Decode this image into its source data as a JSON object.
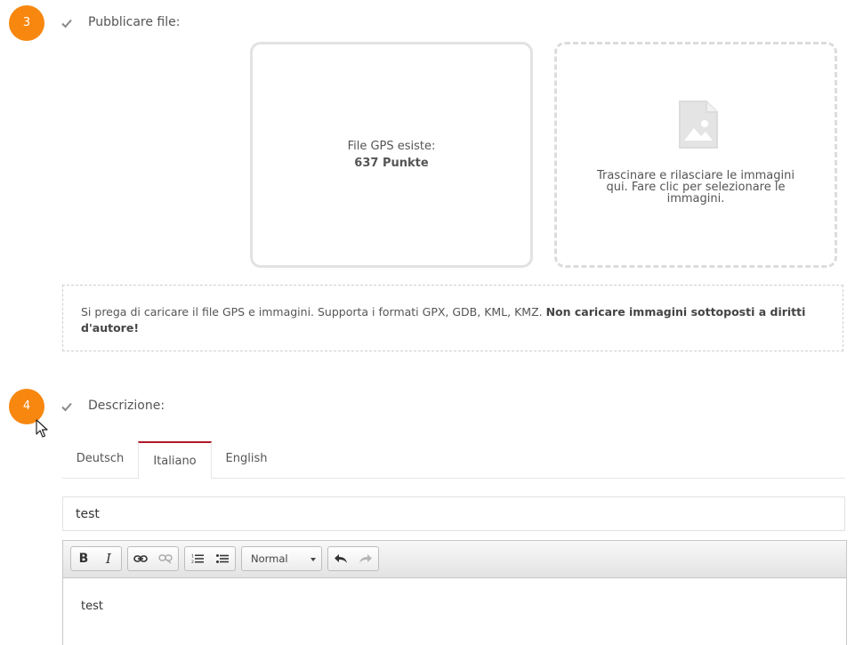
{
  "step3": {
    "number": "3",
    "title": "Pubblicare file:"
  },
  "gps_box": {
    "label": "File GPS esiste:",
    "count": "637 Punkte"
  },
  "image_drop": {
    "icon": "image-file-icon",
    "text": "Trascinare e rilasciare le immagini qui. Fare clic per selezionare le immagini."
  },
  "notice": {
    "text": "Si prega di caricare il file GPS e immagini. Supporta i formati GPX, GDB, KML, KMZ. ",
    "warning": "Non caricare immagini sottoposti a diritti d'autore!"
  },
  "step4": {
    "number": "4",
    "title": "Descrizione:"
  },
  "tabs": [
    {
      "label": "Deutsch",
      "active": false
    },
    {
      "label": "Italiano",
      "active": true
    },
    {
      "label": "English",
      "active": false
    }
  ],
  "title_input": {
    "value": "test"
  },
  "editor": {
    "toolbar": {
      "bold": "B",
      "italic": "I",
      "format_value": "Normal"
    },
    "content": "test"
  },
  "colors": {
    "step_circle": "#f7870f",
    "active_tab_border": "#b01828"
  }
}
